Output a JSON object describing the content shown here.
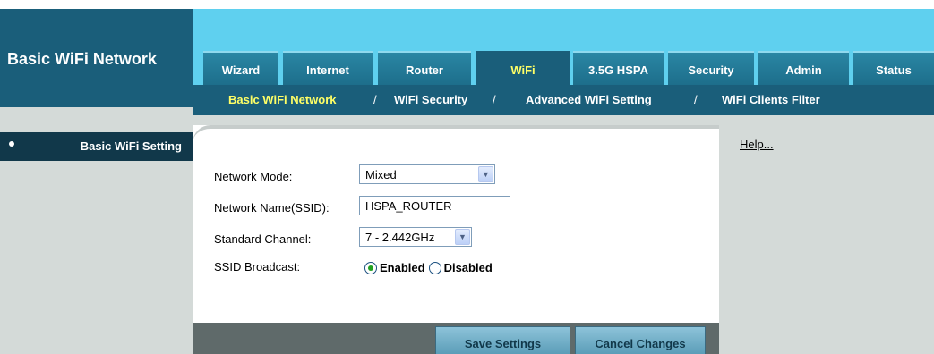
{
  "page_title": "Basic WiFi Network",
  "tabs": [
    {
      "label": "Wizard"
    },
    {
      "label": "Internet"
    },
    {
      "label": "Router"
    },
    {
      "label": "WiFi",
      "active": true
    },
    {
      "label": "3.5G HSPA"
    },
    {
      "label": "Security"
    },
    {
      "label": "Admin"
    },
    {
      "label": "Status"
    }
  ],
  "subnav": {
    "items": [
      {
        "label": "Basic WiFi Network",
        "active": true
      },
      {
        "label": "WiFi Security"
      },
      {
        "label": "Advanced WiFi Setting"
      },
      {
        "label": "WiFi Clients Filter"
      }
    ],
    "separator": "/"
  },
  "sidebar": {
    "items": [
      {
        "label": "Basic WiFi Setting"
      }
    ]
  },
  "form": {
    "network_mode": {
      "label": "Network Mode:",
      "value": "Mixed"
    },
    "network_name": {
      "label": "Network Name(SSID):",
      "value": "HSPA_ROUTER"
    },
    "standard_channel": {
      "label": "Standard Channel:",
      "value": "7 - 2.442GHz"
    },
    "ssid_broadcast": {
      "label": "SSID Broadcast:",
      "options": [
        {
          "label": "Enabled",
          "selected": true
        },
        {
          "label": "Disabled",
          "selected": false
        }
      ]
    }
  },
  "actions": {
    "save_label": "Save Settings",
    "cancel_label": "Cancel Changes"
  },
  "help": {
    "label": "Help..."
  },
  "colors": {
    "header_light": "#5fd0ef",
    "header_dark": "#1a5e7a",
    "active_text": "#ffff66",
    "sidebar_item": "#11384a",
    "panel_gray": "#d4dad8"
  }
}
